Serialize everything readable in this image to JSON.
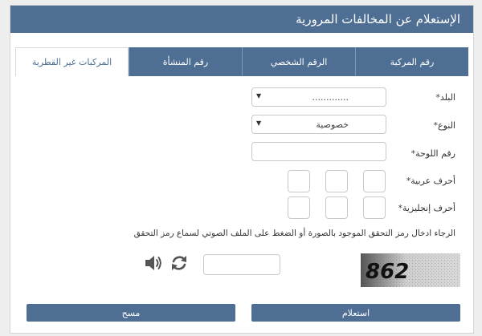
{
  "header": {
    "title": "الإستعلام عن المخالفات المرورية"
  },
  "tabs": [
    {
      "label": "رقم المركبة",
      "active": false
    },
    {
      "label": "الرقم الشخصي",
      "active": false
    },
    {
      "label": "رقم المنشأة",
      "active": false
    },
    {
      "label": "المركبات غير القطرية",
      "active": true
    }
  ],
  "form": {
    "country": {
      "label": "البلد",
      "required_mark": "*",
      "value": "............."
    },
    "type": {
      "label": "النوع",
      "required_mark": "*",
      "value": "خصوصية"
    },
    "plate_number": {
      "label": "رقم اللوحة",
      "required_mark": "*",
      "value": ""
    },
    "arabic_letters": {
      "label": "أحرف عربية",
      "required_mark": "*"
    },
    "english_letters": {
      "label": "أحرف إنجليزية",
      "required_mark": "*"
    }
  },
  "captcha": {
    "instructions": "الرجاء ادخال رمز التحقق الموجود بالصورة أو الضغط على الملف الصوتي لسماع رمز التحقق",
    "image_text": "862",
    "input_value": ""
  },
  "icons": {
    "refresh": "refresh-icon",
    "audio": "speaker-icon"
  },
  "buttons": {
    "search": "استعلام",
    "clear": "مسح"
  },
  "colors": {
    "primary": "#4e6f93",
    "background": "#eeeeee"
  }
}
